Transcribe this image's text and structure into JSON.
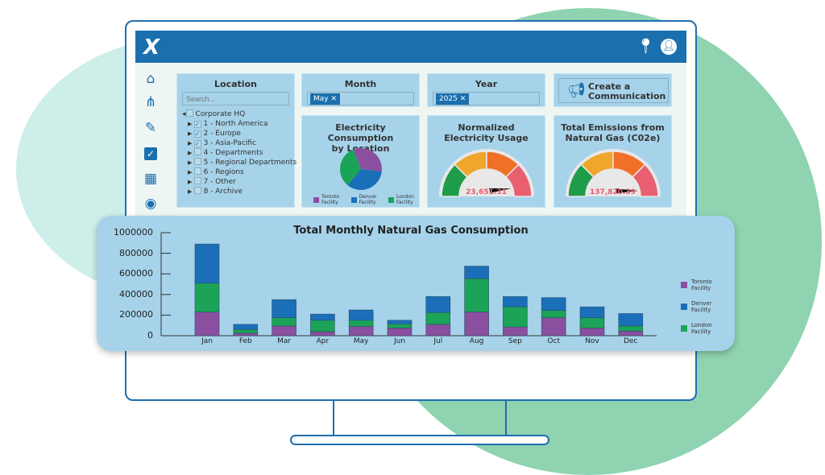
{
  "header": {
    "logo": "X",
    "icons": [
      "map-pin-icon",
      "user-icon"
    ]
  },
  "sidebar": {
    "icons": [
      "home-icon",
      "share-icon",
      "pin-icon",
      "checkbox-icon",
      "dashboard-icon",
      "eye-icon"
    ]
  },
  "location": {
    "title": "Location",
    "placeholder": "Search...",
    "root": "Corporate HQ",
    "items": [
      {
        "label": "1 - North America",
        "checked": true
      },
      {
        "label": "2 - Europe",
        "checked": true
      },
      {
        "label": "3 - Asia-Pacific",
        "checked": true
      },
      {
        "label": "4 - Departments",
        "checked": false
      },
      {
        "label": "5 - Regional Departments",
        "checked": false
      },
      {
        "label": "6 - Regions",
        "checked": false
      },
      {
        "label": "7 - Other",
        "checked": false
      },
      {
        "label": "8 - Archive",
        "checked": false
      }
    ]
  },
  "month": {
    "title": "Month",
    "chip": "May ✕"
  },
  "year": {
    "title": "Year",
    "chip": "2025 ✕"
  },
  "communication": {
    "label_line1": "Create a",
    "label_line2": "Communication",
    "icon": "megaphone-icon"
  },
  "electricity": {
    "title_line1": "Electricity Consumption",
    "title_line2": "by Location",
    "pie": [
      {
        "name": "Toronto Facility",
        "line1": "Toronto",
        "line2": "Facility",
        "value": 33,
        "color": "#8a4f9e"
      },
      {
        "name": "Denver Facility",
        "line1": "Denver",
        "line2": "Facility",
        "value": 34,
        "color": "#1a6fb8"
      },
      {
        "name": "London Facility",
        "line1": "London",
        "line2": "Facility",
        "value": 33,
        "color": "#1ba357"
      }
    ]
  },
  "normalized": {
    "title_line1": "Normalized",
    "title_line2": "Electricity Usage",
    "value": "23,651.31",
    "level": 0.9
  },
  "emissions": {
    "title_line1": "Total Emissions from",
    "title_line2": "Natural Gas (C02e)",
    "value": "137,820.39",
    "level": 0.93
  },
  "gauge_colors": [
    "#1f9c4a",
    "#f0a62a",
    "#f07028",
    "#e85f70"
  ],
  "chart_data": {
    "type": "bar",
    "stacked": true,
    "title": "Total Monthly Natural Gas Consumption",
    "categories": [
      "Jan",
      "Feb",
      "Mar",
      "Apr",
      "May",
      "Jun",
      "Jul",
      "Aug",
      "Sep",
      "Oct",
      "Nov",
      "Dec"
    ],
    "ylim": [
      0,
      1000000
    ],
    "yticks": [
      "0",
      "200000",
      "400000",
      "600000",
      "800000",
      "1000000"
    ],
    "legend": "right",
    "series": [
      {
        "name": "Toronto Facility",
        "line1": "Toronto",
        "line2": "Facility",
        "color": "#8a4f9e",
        "values": [
          230000,
          25000,
          95000,
          40000,
          90000,
          75000,
          110000,
          230000,
          85000,
          175000,
          75000,
          45000
        ]
      },
      {
        "name": "London Facility",
        "line1": "London",
        "line2": "Facility",
        "color": "#1ba357",
        "values": [
          280000,
          35000,
          80000,
          110000,
          60000,
          40000,
          115000,
          325000,
          195000,
          70000,
          100000,
          50000
        ]
      },
      {
        "name": "Denver Facility",
        "line1": "Denver",
        "line2": "Facility",
        "color": "#1a6fb8",
        "values": [
          380000,
          50000,
          175000,
          60000,
          100000,
          35000,
          155000,
          120000,
          100000,
          125000,
          105000,
          120000
        ]
      }
    ],
    "legend_order": [
      0,
      2,
      1
    ]
  }
}
